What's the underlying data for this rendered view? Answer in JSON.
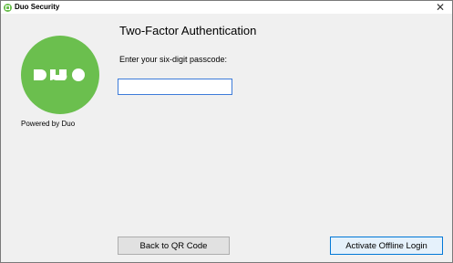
{
  "window": {
    "title": "Duo Security",
    "close_glyph": "✕"
  },
  "brand": {
    "logo_icon": "duo-logo-icon",
    "logo_color": "#6bbf4e",
    "powered_by": "Powered by Duo"
  },
  "main": {
    "heading": "Two-Factor Authentication",
    "prompt": "Enter your six-digit passcode:",
    "passcode": {
      "value": "",
      "placeholder": ""
    }
  },
  "buttons": {
    "back_label": "Back to QR Code",
    "offline_label": "Activate Offline Login"
  },
  "colors": {
    "accent": "#0078d7",
    "focus_border": "#3d7bd9",
    "dialog_bg": "#f0f0f0"
  }
}
